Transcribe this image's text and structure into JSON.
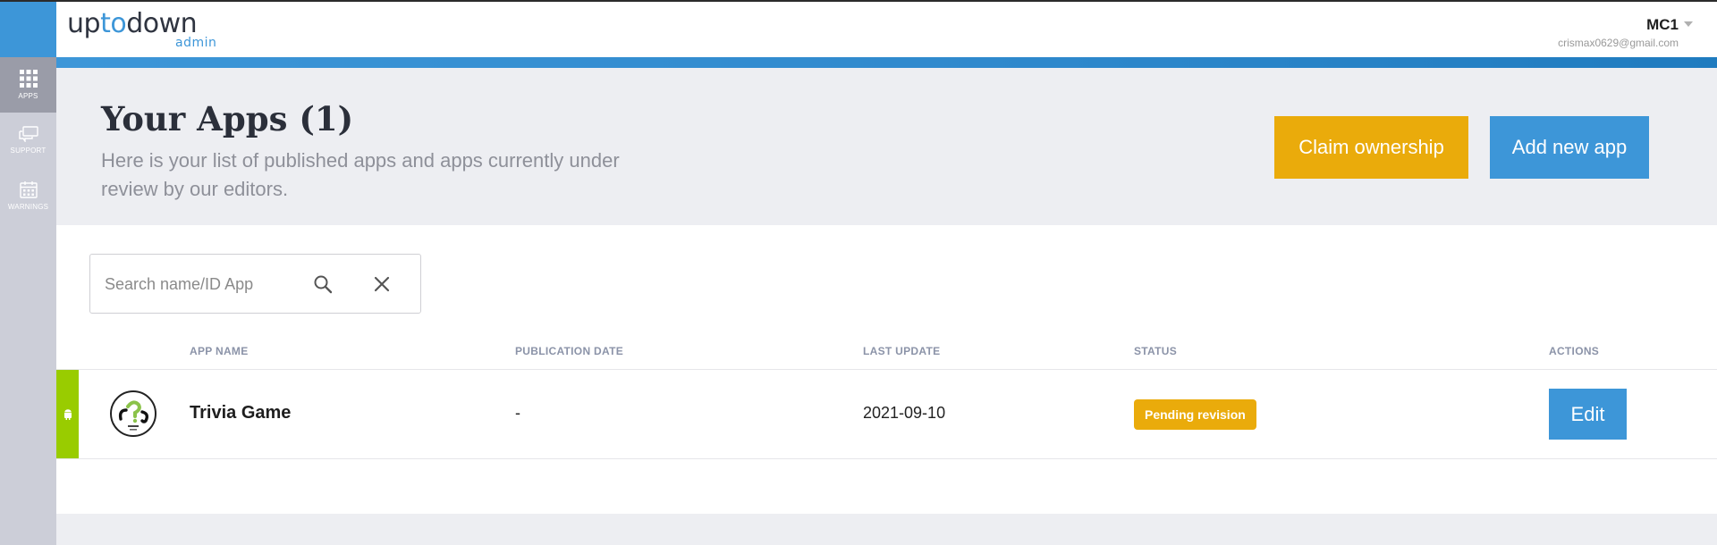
{
  "header": {
    "logo_main_1": "up",
    "logo_main_2": "to",
    "logo_main_3": "down",
    "logo_sub": "admin",
    "user_name": "MC1",
    "user_email": "crismax0629@gmail.com"
  },
  "sidebar": {
    "items": [
      {
        "label": "APPS",
        "icon": "grid-icon",
        "active": true
      },
      {
        "label": "SUPPORT",
        "icon": "chat-icon",
        "active": false
      },
      {
        "label": "WARNINGS",
        "icon": "calendar-icon",
        "active": false
      }
    ]
  },
  "hero": {
    "title": "Your Apps (1)",
    "subtitle": "Here is your list of published apps and apps currently under review by our editors.",
    "claim_label": "Claim ownership",
    "add_label": "Add new app"
  },
  "search": {
    "placeholder": "Search name/ID App",
    "value": ""
  },
  "table": {
    "headers": [
      "APP NAME",
      "PUBLICATION DATE",
      "LAST UPDATE",
      "STATUS",
      "ACTIONS"
    ],
    "rows": [
      {
        "platform": "android",
        "name": "Trivia Game",
        "publication_date": "-",
        "last_update": "2021-09-10",
        "status": "Pending revision",
        "action": "Edit"
      }
    ]
  },
  "colors": {
    "brand_blue": "#3d96d8",
    "claim_yellow": "#eaab0b",
    "android_green": "#99cc00",
    "sidebar_bg": "#ccced8",
    "hero_bg": "#edeef2"
  }
}
